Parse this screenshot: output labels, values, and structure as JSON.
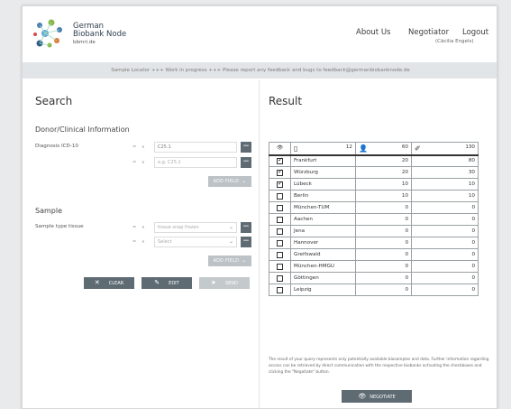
{
  "header": {
    "brand_line1": "German",
    "brand_line2": "Biobank Node",
    "brand_url": "bbmri.de",
    "nav": {
      "about": "About Us",
      "negotiator": "Negotiator",
      "logout": "Logout"
    },
    "user": "(Cäcilia Engels)"
  },
  "banner": "Sample Locator +++ Work in progress +++ Please report any feedback and bugs to feedback@germanbiobanknode.de",
  "search": {
    "title": "Search",
    "donor": {
      "title": "Donor/Clinical Information",
      "diagnosis_label": "Diagnosis ICD-10",
      "diagnosis_value": "C25.1",
      "diagnosis_placeholder": "e.g. C25.1",
      "add_field": "ADD FIELD"
    },
    "sample": {
      "title": "Sample",
      "type_label": "Sample type tissue",
      "type_value": "tissue snap frozen",
      "type_placeholder": "Select",
      "add_field": "ADD FIELD"
    },
    "mini_sel": {
      "a": "=",
      "b": "∨"
    },
    "buttons": {
      "clear": "CLEAR",
      "edit": "EDIT",
      "send": "SEND"
    }
  },
  "result": {
    "title": "Result",
    "header": {
      "biobanks": "12",
      "donors": "60",
      "samples": "130"
    },
    "rows": [
      {
        "name": "Frankfurt",
        "donors": "20",
        "samples": "80",
        "checked": true
      },
      {
        "name": "Würzburg",
        "donors": "20",
        "samples": "30",
        "checked": true
      },
      {
        "name": "Lübeck",
        "donors": "10",
        "samples": "10",
        "checked": true
      },
      {
        "name": "Berlin",
        "donors": "10",
        "samples": "10",
        "checked": false
      },
      {
        "name": "München-TUM",
        "donors": "0",
        "samples": "0",
        "checked": false
      },
      {
        "name": "Aachen",
        "donors": "0",
        "samples": "0",
        "checked": false
      },
      {
        "name": "Jena",
        "donors": "0",
        "samples": "0",
        "checked": false
      },
      {
        "name": "Hannover",
        "donors": "0",
        "samples": "0",
        "checked": false
      },
      {
        "name": "Greifswald",
        "donors": "0",
        "samples": "0",
        "checked": false
      },
      {
        "name": "München-HMGU",
        "donors": "0",
        "samples": "0",
        "checked": false
      },
      {
        "name": "Göttingen",
        "donors": "0",
        "samples": "0",
        "checked": false
      },
      {
        "name": "Leipzig",
        "donors": "0",
        "samples": "0",
        "checked": false
      }
    ],
    "note": "The result of your query represents only potentially available biosamples and data. Further information regarding access can be retrieved by direct communication with the respective biobanks activating the checkboxes and clicking the \"Negotiate\" button.",
    "negotiate": "NEGOTIATE"
  },
  "colors": {
    "accent": "#5f6b73",
    "disabled": "#c4c9cc",
    "banner": "#e2e5e7"
  }
}
